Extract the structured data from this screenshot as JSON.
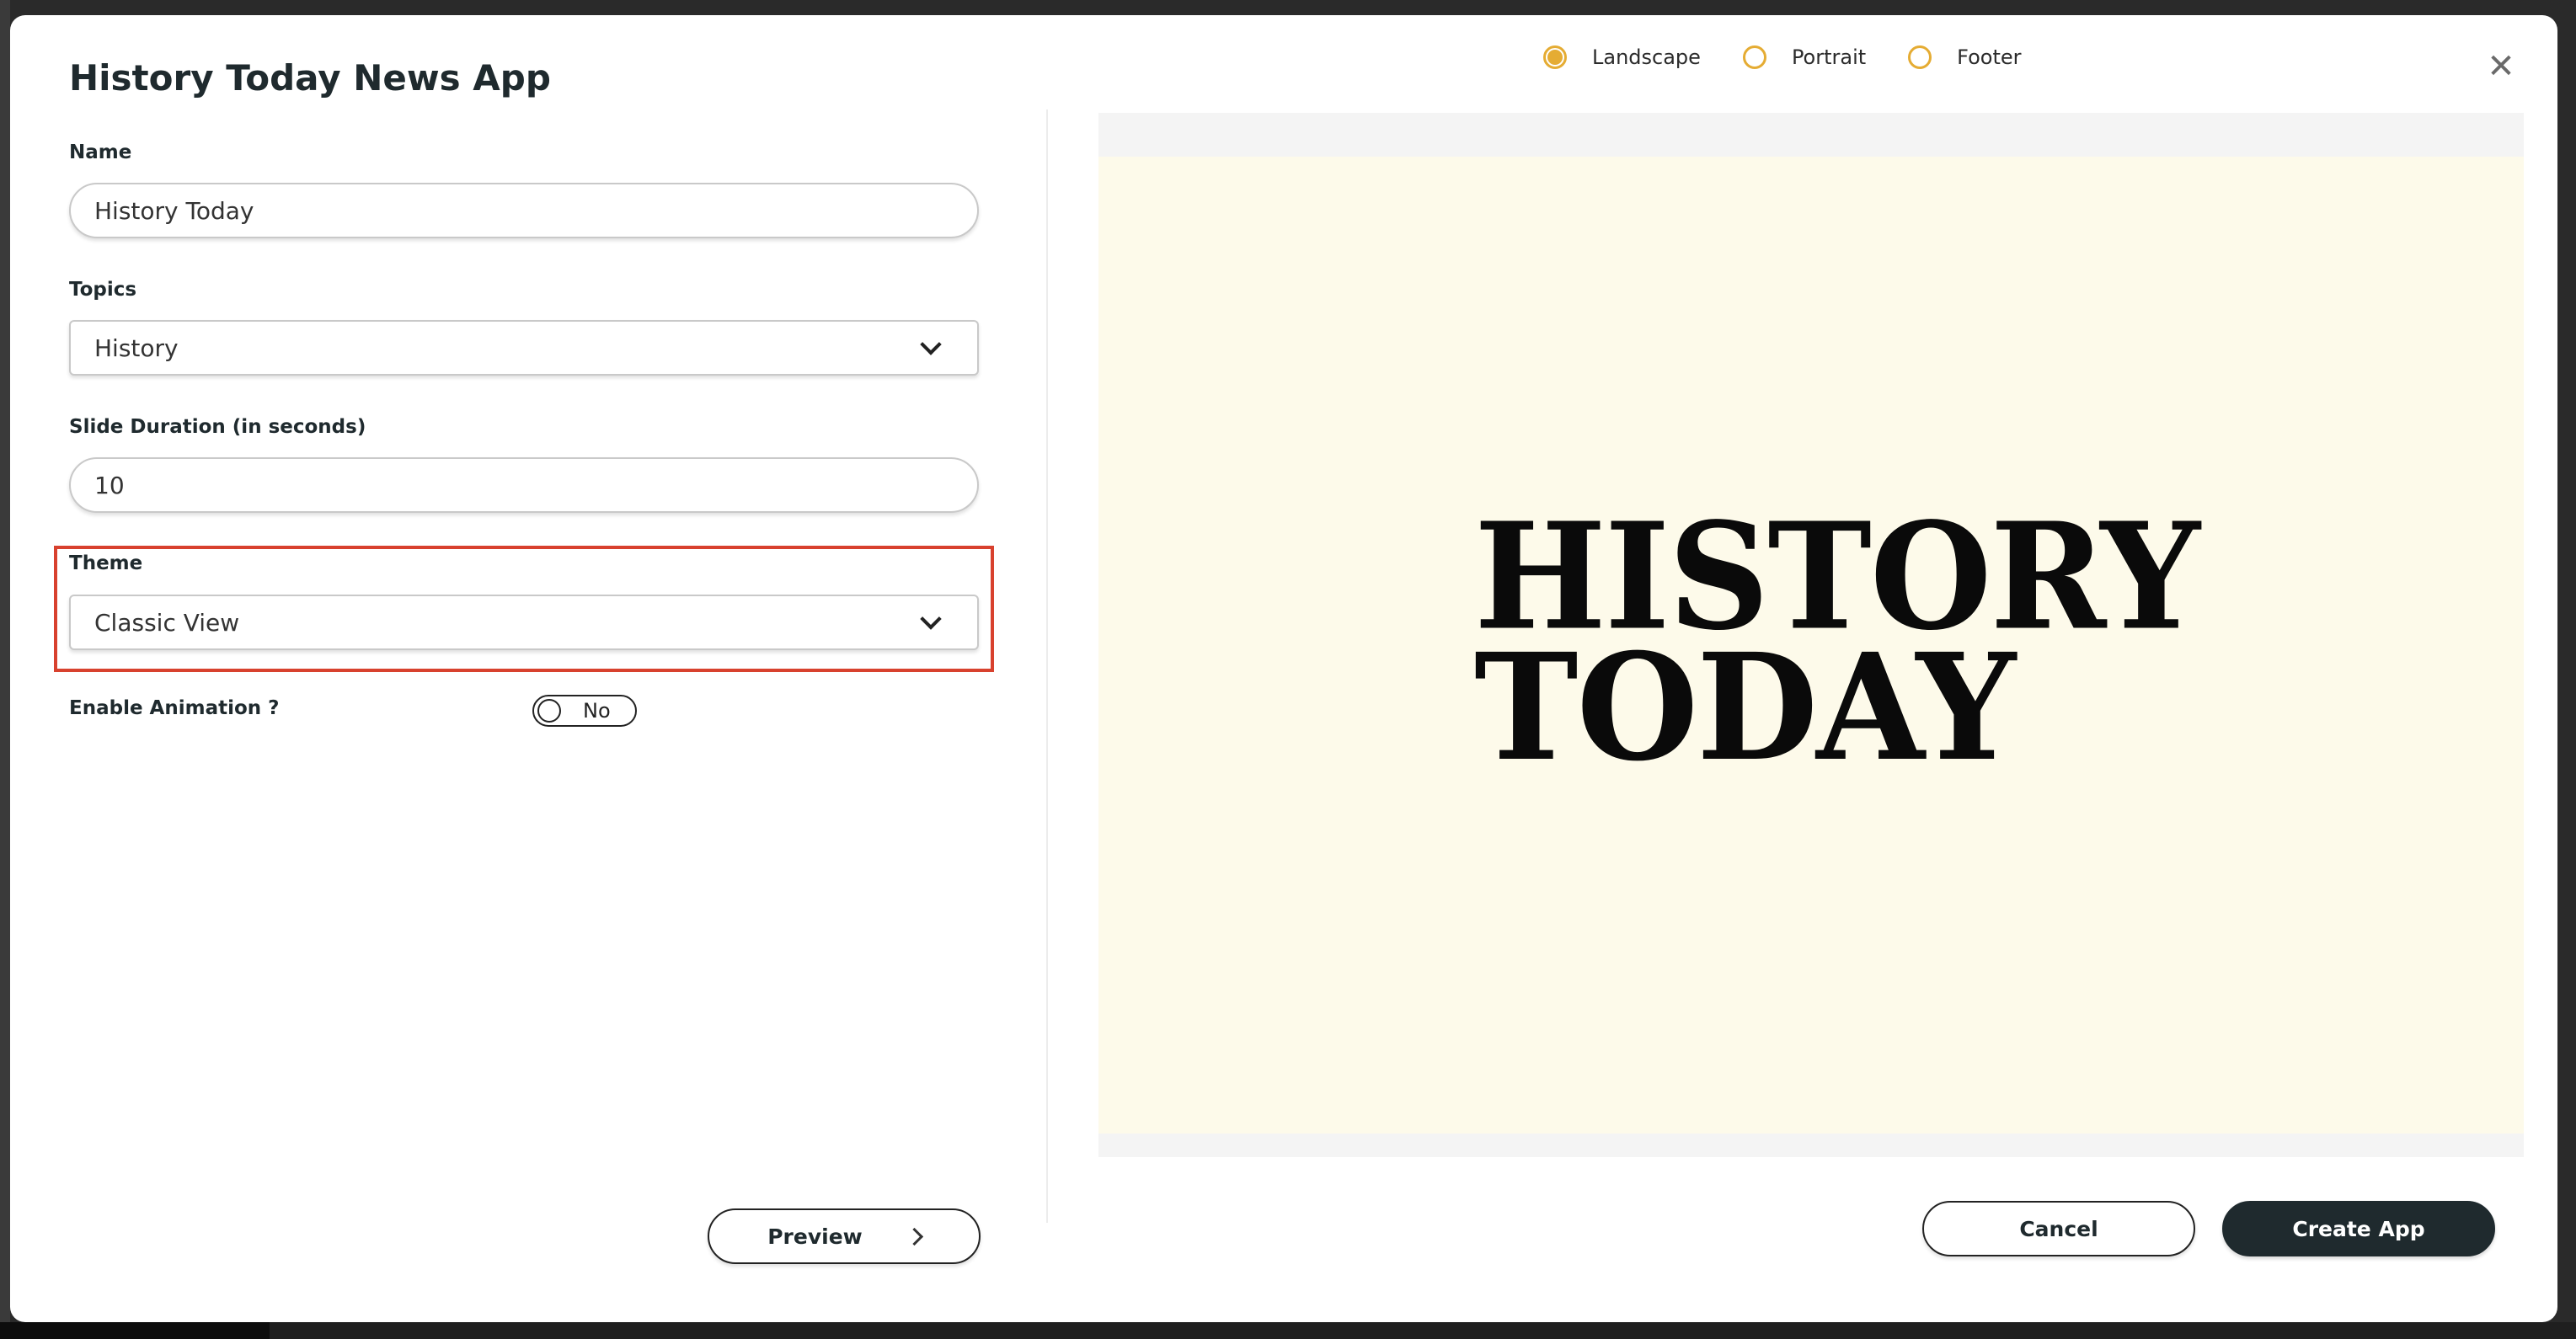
{
  "modal": {
    "title": "History Today News App",
    "close_icon": "close-icon"
  },
  "orientation": {
    "options": [
      {
        "label": "Landscape",
        "checked": true
      },
      {
        "label": "Portrait",
        "checked": false
      },
      {
        "label": "Footer",
        "checked": false
      }
    ],
    "accent_color": "#e5ac33"
  },
  "form": {
    "name": {
      "label": "Name",
      "value": "History Today"
    },
    "topics": {
      "label": "Topics",
      "value": "History"
    },
    "slide_duration": {
      "label": "Slide Duration (in seconds)",
      "value": "10"
    },
    "theme": {
      "label": "Theme",
      "value": "Classic View"
    },
    "animation": {
      "label": "Enable Animation ?",
      "toggle_text": "No"
    }
  },
  "preview": {
    "logo_line1": "HISTORY",
    "logo_line2": "TODAY",
    "background_color": "#fdfaea"
  },
  "buttons": {
    "preview": "Preview",
    "cancel": "Cancel",
    "create": "Create App"
  },
  "colors": {
    "primary_dark": "#1f2a2e",
    "highlight": "#d8412e"
  }
}
